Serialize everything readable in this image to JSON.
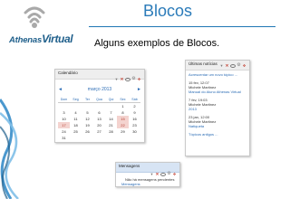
{
  "logo": {
    "part1": "Athenas",
    "part2": "Virtual"
  },
  "slide": {
    "title": "Blocos",
    "subtitle": "Alguns exemplos de Blocos."
  },
  "colors": {
    "accent": "#2b7bb9",
    "link": "#2b6cb5",
    "highlight": "#f4d3cf"
  },
  "calendar": {
    "title": "Calendário",
    "month": "março 2013",
    "prev_icon": "chevron-left-icon",
    "next_icon": "chevron-right-icon",
    "weekdays": [
      "Dom",
      "Seg",
      "Ter",
      "Qua",
      "Qui",
      "Sex",
      "Sáb"
    ],
    "weeks": [
      [
        "",
        "",
        "",
        "",
        "",
        "1",
        "2"
      ],
      [
        "3",
        "4",
        "5",
        "6",
        "7",
        "8",
        "9"
      ],
      [
        "10",
        "11",
        "12",
        "13",
        "14",
        "15",
        "16"
      ],
      [
        "17",
        "18",
        "19",
        "20",
        "21",
        "22",
        "23"
      ],
      [
        "24",
        "25",
        "26",
        "27",
        "28",
        "29",
        "30"
      ],
      [
        "31",
        "",
        "",
        "",
        "",
        "",
        ""
      ]
    ],
    "highlighted_days": [
      "15",
      "17",
      "22"
    ]
  },
  "news": {
    "title": "Últimas notícias",
    "add_link": "Acrescentar um novo tópico ...",
    "items": [
      {
        "date": "15 fev, 12:07",
        "author": "Michele Martinez",
        "text": "Manual do Aluno Athenas Virtual"
      },
      {
        "date": "7 fev, 19:03",
        "author": "Michele Martinez",
        "text": "2013"
      },
      {
        "date": "23 jan, 12:00",
        "author": "Michele Martinez",
        "text": "Natiqueta"
      }
    ],
    "older": "Tópicos antigos ..."
  },
  "messages": {
    "title": "Mensagens",
    "empty_text": "Não há mensagens pendentes",
    "link": "Mensagens"
  },
  "controls_icons": [
    "chevron-down-icon",
    "close-icon",
    "eye-icon",
    "gear-icon",
    "move-icon"
  ]
}
